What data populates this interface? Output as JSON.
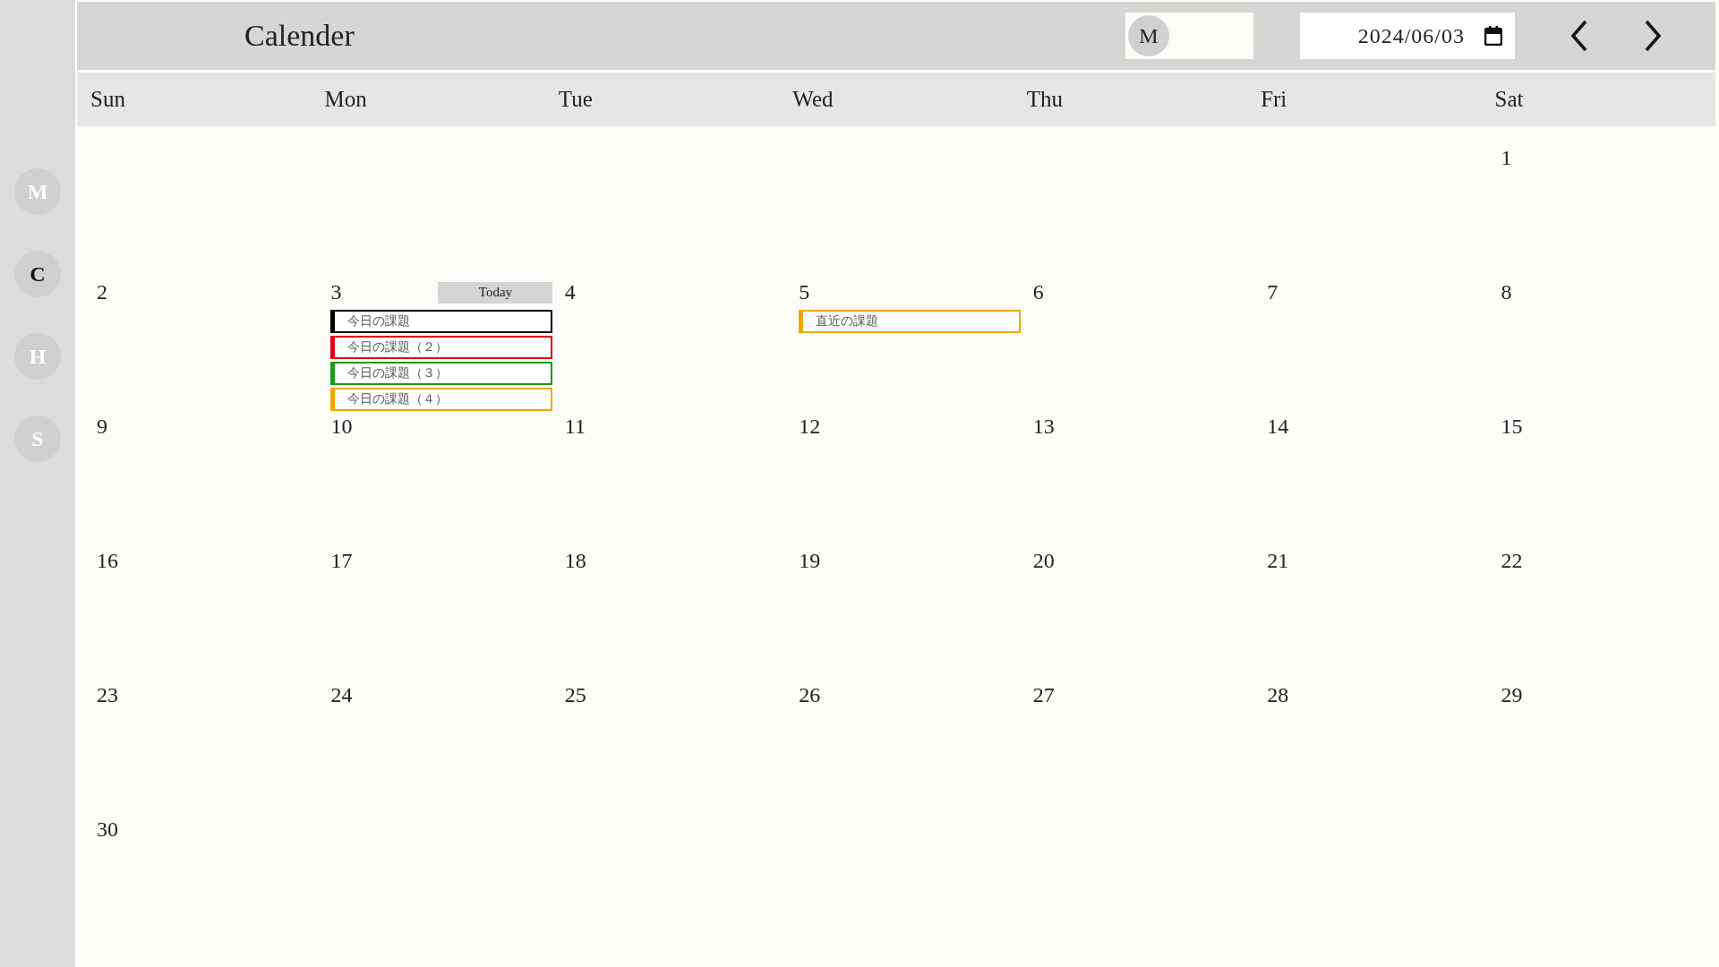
{
  "sidebar": {
    "items": [
      {
        "label": "M",
        "selected": false
      },
      {
        "label": "C",
        "selected": true
      },
      {
        "label": "H",
        "selected": false
      },
      {
        "label": "S",
        "selected": false
      }
    ]
  },
  "header": {
    "title": "Calender",
    "user_avatar": "M",
    "date_value": "2024/06/03"
  },
  "weekdays": [
    "Sun",
    "Mon",
    "Tue",
    "Wed",
    "Thu",
    "Fri",
    "Sat"
  ],
  "weeks": [
    {
      "cells": [
        {
          "kind": "blank"
        },
        {
          "kind": "blank"
        },
        {
          "kind": "blank"
        },
        {
          "kind": "blank"
        },
        {
          "kind": "blank"
        },
        {
          "kind": "blank"
        },
        {
          "kind": "day",
          "day": "1"
        }
      ]
    },
    {
      "cells": [
        {
          "kind": "day",
          "day": "2"
        },
        {
          "kind": "today",
          "day": "3",
          "today_label": "Today",
          "events": [
            {
              "title": "今日の課題",
              "color": "#000000"
            },
            {
              "title": "今日の課題（２）",
              "color": "#e0001b"
            },
            {
              "title": "今日の課題（３）",
              "color": "#1a9a1a"
            },
            {
              "title": "今日の課題（４）",
              "color": "#f0a800"
            }
          ]
        },
        {
          "kind": "day",
          "day": "4"
        },
        {
          "kind": "day",
          "day": "5",
          "events": [
            {
              "title": "直近の課題",
              "color": "#f0a800"
            }
          ]
        },
        {
          "kind": "day",
          "day": "6"
        },
        {
          "kind": "day",
          "day": "7"
        },
        {
          "kind": "day",
          "day": "8"
        }
      ]
    },
    {
      "cells": [
        {
          "kind": "day",
          "day": "9"
        },
        {
          "kind": "day",
          "day": "10"
        },
        {
          "kind": "day",
          "day": "11"
        },
        {
          "kind": "day",
          "day": "12"
        },
        {
          "kind": "day",
          "day": "13"
        },
        {
          "kind": "day",
          "day": "14"
        },
        {
          "kind": "day",
          "day": "15"
        }
      ]
    },
    {
      "cells": [
        {
          "kind": "day",
          "day": "16"
        },
        {
          "kind": "day",
          "day": "17"
        },
        {
          "kind": "day",
          "day": "18"
        },
        {
          "kind": "day",
          "day": "19"
        },
        {
          "kind": "day",
          "day": "20"
        },
        {
          "kind": "day",
          "day": "21"
        },
        {
          "kind": "day",
          "day": "22"
        }
      ]
    },
    {
      "cells": [
        {
          "kind": "day",
          "day": "23"
        },
        {
          "kind": "day",
          "day": "24"
        },
        {
          "kind": "day",
          "day": "25"
        },
        {
          "kind": "day",
          "day": "26"
        },
        {
          "kind": "day",
          "day": "27"
        },
        {
          "kind": "day",
          "day": "28"
        },
        {
          "kind": "day",
          "day": "29"
        }
      ]
    },
    {
      "cells": [
        {
          "kind": "day",
          "day": "30"
        },
        {
          "kind": "blank"
        },
        {
          "kind": "blank"
        },
        {
          "kind": "blank"
        },
        {
          "kind": "blank"
        },
        {
          "kind": "blank"
        },
        {
          "kind": "blank"
        }
      ]
    }
  ]
}
